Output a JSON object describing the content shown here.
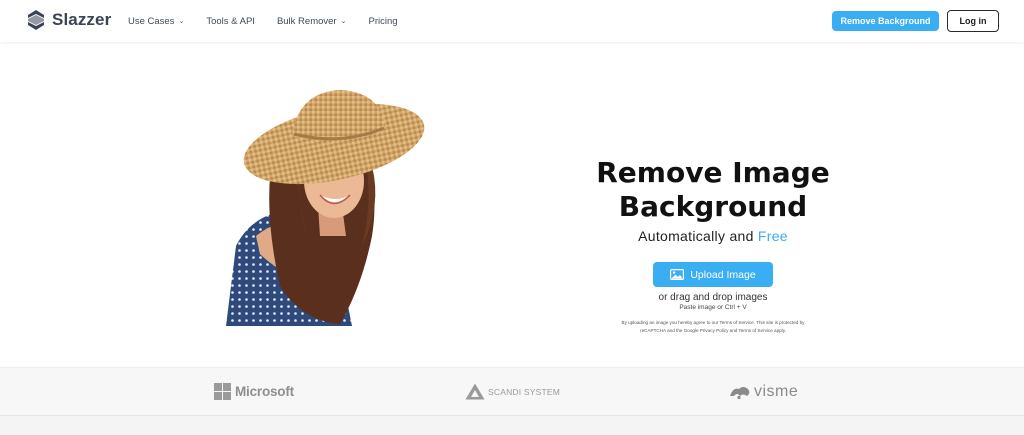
{
  "brand": {
    "name": "Slazzer"
  },
  "nav": {
    "items": [
      {
        "label": "Use Cases",
        "has_dropdown": true
      },
      {
        "label": "Tools & API",
        "has_dropdown": false
      },
      {
        "label": "Bulk Remover",
        "has_dropdown": true
      },
      {
        "label": "Pricing",
        "has_dropdown": false
      }
    ],
    "cta_label": "Remove Background",
    "login_label": "Log in"
  },
  "hero": {
    "title_line1": "Remove Image",
    "title_line2": "Background",
    "subtitle_plain": "Automatically and ",
    "subtitle_accent": "Free",
    "upload_label": "Upload Image",
    "drag_text": "or drag and drop images",
    "paste_text": "Paste image or Ctrl + V",
    "legal_line1": "By uploading an image you hereby agree to our Terms of Service. This site is protected by",
    "legal_line2": "reCAPTCHA and the Google Privacy Policy and Terms of Service apply."
  },
  "brands": [
    {
      "name": "Microsoft"
    },
    {
      "name": "SCANDI SYSTEM"
    },
    {
      "name": "visme"
    }
  ],
  "colors": {
    "accent": "#3aaef2",
    "nav_text": "#3f4a5a",
    "brand_logo_gray": "#8f8f8f"
  },
  "icons": {
    "logo": "slazzer-logo-icon",
    "dropdown": "chevron-down-icon",
    "upload": "image-icon"
  }
}
